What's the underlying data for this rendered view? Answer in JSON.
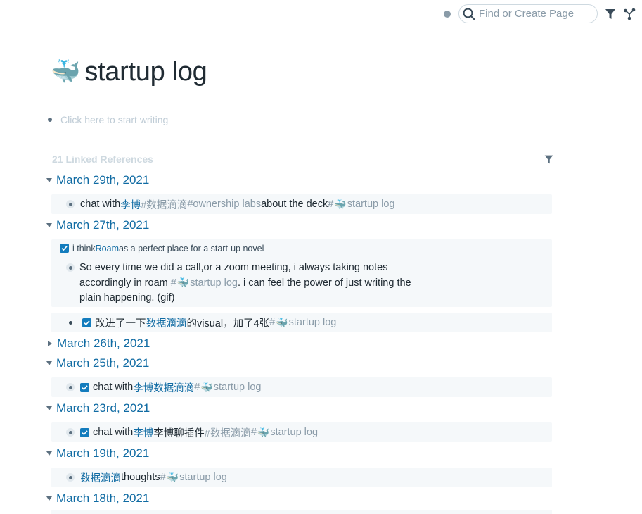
{
  "topbar": {
    "search_placeholder": "Find or Create Page",
    "icons": [
      "sync-status-dot",
      "search-icon",
      "filter-icon",
      "graph-icon"
    ]
  },
  "page": {
    "emoji": "🐳",
    "title": "startup log",
    "empty_placeholder": "Click here to start writing"
  },
  "references": {
    "header": "21 Linked References",
    "groups": [
      {
        "date": "March 29th, 2021",
        "blocks": [
          {
            "parts": [
              "chat with ",
              "李博",
              " #数据滴滴",
              " #ownership labs",
              " about the deck ",
              "#",
              "🐳",
              "startup log"
            ]
          }
        ]
      },
      {
        "date": "March 27th, 2021",
        "blocks": [
          {
            "parent_parts": [
              "i think ",
              "Roam",
              " as a perfect place for a start-up novel"
            ],
            "child_lines": [
              "So every time we did a call,or a zoom meeting, i always taking notes",
              [
                "accordingly in roam ",
                "#",
                "🐳",
                "startup log",
                ". i can feel the power of just writing the"
              ],
              "plain happening. (gif)"
            ]
          },
          {
            "parts": [
              "改进了一下",
              "数据滴滴",
              "的visual，加了4张 ",
              "#",
              "🐳",
              "startup log"
            ]
          }
        ]
      },
      {
        "date": "March 26th, 2021",
        "collapsed": true
      },
      {
        "date": "March 25th, 2021",
        "blocks": [
          {
            "parts": [
              "chat with ",
              "李博",
              " ",
              "数据滴滴",
              " #",
              "🐳",
              "startup log"
            ]
          }
        ]
      },
      {
        "date": "March 23rd, 2021",
        "blocks": [
          {
            "parts": [
              "chat with ",
              "李博",
              " 李博聊插件 ",
              "#数据滴滴",
              " #",
              "🐳",
              "startup log"
            ]
          }
        ]
      },
      {
        "date": "March 19th, 2021",
        "blocks": [
          {
            "parts": [
              "数据滴滴",
              " thoughts ",
              "#",
              "🐳",
              "startup log"
            ]
          }
        ]
      },
      {
        "date": "March 18th, 2021"
      }
    ]
  }
}
